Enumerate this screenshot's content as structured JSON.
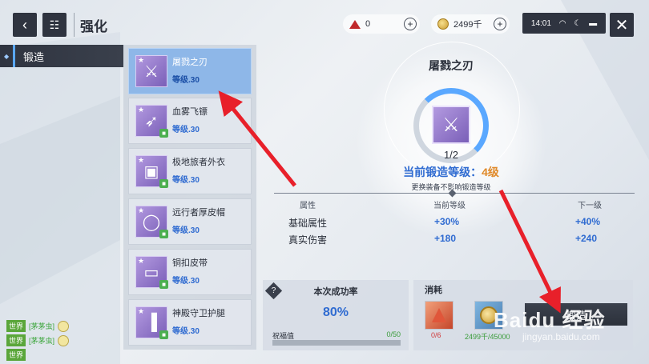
{
  "header": {
    "back_icon": "back-arrow-icon",
    "menu_icon": "grid-menu-icon",
    "title": "强化",
    "crystal": {
      "icon": "red-crystal-icon",
      "value": "0",
      "plus": "+"
    },
    "coin": {
      "icon": "gold-coin-icon",
      "value": "2499千",
      "plus": "+"
    },
    "status": {
      "time": "14:01",
      "wifi_icon": "wifi-icon",
      "moon_icon": "moon-icon",
      "battery_icon": "battery-icon"
    },
    "close_icon": "close-icon"
  },
  "side_nav": {
    "items": [
      {
        "label": "锻造",
        "active": true
      }
    ]
  },
  "equipment_list": [
    {
      "name": "屠戮之刃",
      "level": "等级.30",
      "icon": "crossed-blades-icon",
      "selected": true
    },
    {
      "name": "血雾飞镖",
      "level": "等级.30",
      "icon": "dart-icon",
      "selected": false
    },
    {
      "name": "极地旅者外衣",
      "level": "等级.30",
      "icon": "coat-icon",
      "selected": false
    },
    {
      "name": "远行者厚皮帽",
      "level": "等级.30",
      "icon": "hat-icon",
      "selected": false
    },
    {
      "name": "铜扣皮带",
      "level": "等级.30",
      "icon": "belt-icon",
      "selected": false
    },
    {
      "name": "神殿守卫护腿",
      "level": "等级.30",
      "icon": "leggings-icon",
      "selected": false
    }
  ],
  "detail": {
    "name": "屠戮之刃",
    "progress_text": "1/2",
    "progress_fraction": 0.5,
    "forge_level_label": "当前锻造等级：",
    "forge_level_value": "4级",
    "note": "更换装备不影响锻造等级"
  },
  "stats": {
    "headers": {
      "attribute": "属性",
      "current": "当前等级",
      "next": "下一级"
    },
    "rows": [
      {
        "name": "基础属性",
        "current": "+30%",
        "next": "+40%"
      },
      {
        "name": "真实伤害",
        "current": "+180",
        "next": "+240"
      }
    ]
  },
  "success": {
    "label": "本次成功率",
    "rate": "80%",
    "blessing_label": "祝福值",
    "blessing_value": "0/50",
    "blessing_fraction": 0.0
  },
  "cost": {
    "title": "消耗",
    "items": [
      {
        "icon": "red-crystal-icon",
        "amount": "0/6"
      },
      {
        "icon": "gold-coin-icon",
        "amount": "2499千/45000"
      }
    ],
    "button_label": "锻造"
  },
  "chat": [
    {
      "channel": "世界",
      "name": "[茅茅虫]"
    },
    {
      "channel": "世界",
      "name": "[茅茅虫]"
    },
    {
      "channel": "世界",
      "name": ""
    }
  ],
  "watermark": {
    "brand": "Baidu 经验",
    "url": "jingyan.baidu.com"
  },
  "colors": {
    "accent": "#2f6bd1",
    "selected_item": "#8eb7e8",
    "level_orange": "#e08a2a",
    "arrow_red": "#e8202a"
  }
}
